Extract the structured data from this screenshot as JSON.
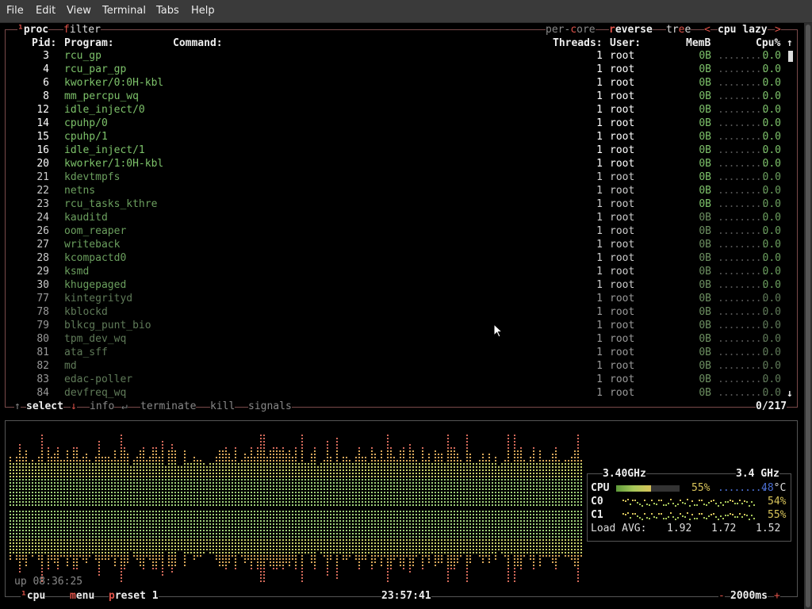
{
  "menu": [
    "File",
    "Edit",
    "View",
    "Terminal",
    "Tabs",
    "Help"
  ],
  "proc": {
    "title": "proc",
    "filter": "filter",
    "options": {
      "per_core": "per-core",
      "reverse": "reverse",
      "tree": "tree",
      "lt": "<",
      "sort": "cpu lazy",
      "gt": ">"
    },
    "headers": {
      "pid": "Pid:",
      "program": "Program:",
      "command": "Command:",
      "threads": "Threads:",
      "user": "User:",
      "mem": "MemB",
      "cpu": "Cpu%"
    },
    "rows": [
      {
        "pid": "3",
        "program": "rcu_gp",
        "threads": "1",
        "user": "root",
        "mem": "0B",
        "cpu": "0.0"
      },
      {
        "pid": "4",
        "program": "rcu_par_gp",
        "threads": "1",
        "user": "root",
        "mem": "0B",
        "cpu": "0.0"
      },
      {
        "pid": "6",
        "program": "kworker/0:0H-kbl",
        "threads": "1",
        "user": "root",
        "mem": "0B",
        "cpu": "0.0"
      },
      {
        "pid": "8",
        "program": "mm_percpu_wq",
        "threads": "1",
        "user": "root",
        "mem": "0B",
        "cpu": "0.0"
      },
      {
        "pid": "12",
        "program": "idle_inject/0",
        "threads": "1",
        "user": "root",
        "mem": "0B",
        "cpu": "0.0"
      },
      {
        "pid": "14",
        "program": "cpuhp/0",
        "threads": "1",
        "user": "root",
        "mem": "0B",
        "cpu": "0.0"
      },
      {
        "pid": "15",
        "program": "cpuhp/1",
        "threads": "1",
        "user": "root",
        "mem": "0B",
        "cpu": "0.0"
      },
      {
        "pid": "16",
        "program": "idle_inject/1",
        "threads": "1",
        "user": "root",
        "mem": "0B",
        "cpu": "0.0"
      },
      {
        "pid": "20",
        "program": "kworker/1:0H-kbl",
        "threads": "1",
        "user": "root",
        "mem": "0B",
        "cpu": "0.0"
      },
      {
        "pid": "21",
        "program": "kdevtmpfs",
        "threads": "1",
        "user": "root",
        "mem": "0B",
        "cpu": "0.0"
      },
      {
        "pid": "22",
        "program": "netns",
        "threads": "1",
        "user": "root",
        "mem": "0B",
        "cpu": "0.0"
      },
      {
        "pid": "23",
        "program": "rcu_tasks_kthre",
        "threads": "1",
        "user": "root",
        "mem": "0B",
        "cpu": "0.0"
      },
      {
        "pid": "24",
        "program": "kauditd",
        "threads": "1",
        "user": "root",
        "mem": "0B",
        "cpu": "0.0"
      },
      {
        "pid": "26",
        "program": "oom_reaper",
        "threads": "1",
        "user": "root",
        "mem": "0B",
        "cpu": "0.0"
      },
      {
        "pid": "27",
        "program": "writeback",
        "threads": "1",
        "user": "root",
        "mem": "0B",
        "cpu": "0.0"
      },
      {
        "pid": "28",
        "program": "kcompactd0",
        "threads": "1",
        "user": "root",
        "mem": "0B",
        "cpu": "0.0"
      },
      {
        "pid": "29",
        "program": "ksmd",
        "threads": "1",
        "user": "root",
        "mem": "0B",
        "cpu": "0.0"
      },
      {
        "pid": "30",
        "program": "khugepaged",
        "threads": "1",
        "user": "root",
        "mem": "0B",
        "cpu": "0.0"
      },
      {
        "pid": "77",
        "program": "kintegrityd",
        "threads": "1",
        "user": "root",
        "mem": "0B",
        "cpu": "0.0"
      },
      {
        "pid": "78",
        "program": "kblockd",
        "threads": "1",
        "user": "root",
        "mem": "0B",
        "cpu": "0.0"
      },
      {
        "pid": "79",
        "program": "blkcg_punt_bio",
        "threads": "1",
        "user": "root",
        "mem": "0B",
        "cpu": "0.0"
      },
      {
        "pid": "80",
        "program": "tpm_dev_wq",
        "threads": "1",
        "user": "root",
        "mem": "0B",
        "cpu": "0.0"
      },
      {
        "pid": "81",
        "program": "ata_sff",
        "threads": "1",
        "user": "root",
        "mem": "0B",
        "cpu": "0.0"
      },
      {
        "pid": "82",
        "program": "md",
        "threads": "1",
        "user": "root",
        "mem": "0B",
        "cpu": "0.0"
      },
      {
        "pid": "83",
        "program": "edac-poller",
        "threads": "1",
        "user": "root",
        "mem": "0B",
        "cpu": "0.0"
      },
      {
        "pid": "84",
        "program": "devfreq_wq",
        "threads": "1",
        "user": "root",
        "mem": "0B",
        "cpu": "0.0"
      }
    ],
    "dots": ".........",
    "footer": {
      "up_arrow": "↑",
      "select": "select",
      "down_arrow": "↓",
      "info": "info",
      "enter": "↵",
      "terminate": "terminate",
      "kill": "kill",
      "signals": "signals",
      "count": "0/217"
    },
    "scroll_up": "↑",
    "scroll_down": "↓"
  },
  "cpu": {
    "uptime": "up 08:36:25",
    "freq_left": "3.40GHz",
    "freq_right": "3.4 GHz",
    "cpu_label": "CPU",
    "cpu_pct": "55%",
    "temp_value": "48",
    "temp_unit": "°C",
    "cpu_fill": 0.55,
    "c0_label": "C0",
    "c0_pct": "54%",
    "c1_label": "C1",
    "c1_pct": "55%",
    "load_label": "Load AVG:",
    "load1": "1.92",
    "load5": "1.72",
    "load15": "1.52",
    "footer": {
      "cpu_label": "cpu",
      "menu_label": "menu",
      "preset_label": "preset 1",
      "clock": "23:57:41",
      "minus": "-",
      "interval": "2000ms",
      "plus": "+"
    }
  }
}
